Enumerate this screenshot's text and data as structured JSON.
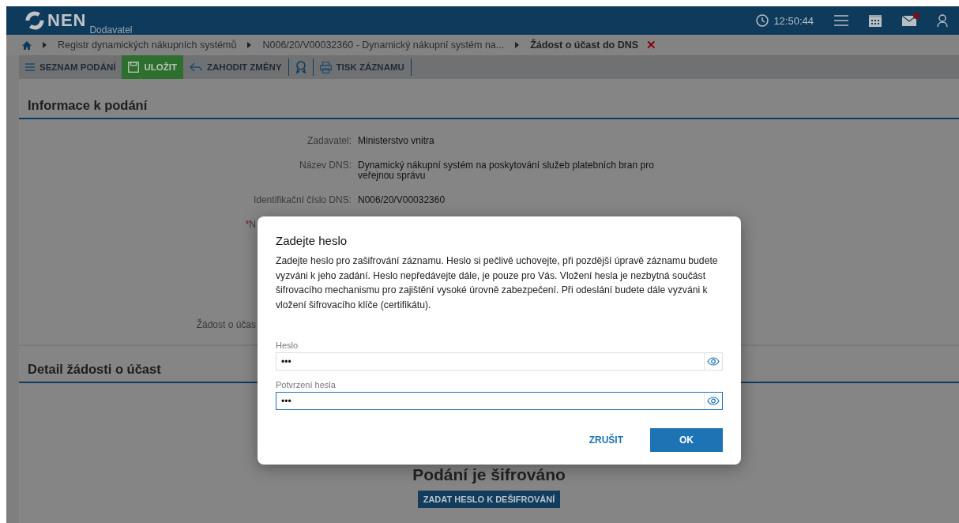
{
  "header": {
    "logo": "NEN",
    "subtitle": "Dodavatel",
    "time": "12:50:44",
    "mail_unread": true
  },
  "breadcrumb": [
    {
      "label": "Registr dynamických nákupních systémů",
      "current": false
    },
    {
      "label": "N006/20/V00032360 - Dynamický nákupní systém na...",
      "current": false
    },
    {
      "label": "Žádost o účast do DNS",
      "current": true,
      "close": "✕"
    }
  ],
  "toolbar": [
    {
      "kind": "list",
      "label": "SEZNAM PODÁNÍ",
      "primary": false
    },
    {
      "kind": "save",
      "label": "ULOŽIT",
      "primary": true
    },
    {
      "kind": "discard",
      "label": "ZAHODIT ZMĚNY",
      "primary": false
    },
    {
      "kind": "award",
      "primary": false
    },
    {
      "kind": "print",
      "label": "TISK ZÁZNAMU",
      "primary": false
    }
  ],
  "info_section": {
    "title": "Informace k podání",
    "fields": [
      {
        "kind": "plain",
        "label": "Zadavatel:",
        "value": "Ministerstvo vnitra"
      },
      {
        "kind": "plain",
        "label": "Název DNS:",
        "value": "Dynamický nákupní systém na poskytování služeb platebních bran pro veřejnou správu"
      },
      {
        "kind": "plain",
        "label": "Identifikační číslo DNS:",
        "value": "N006/20/V00032360"
      },
      {
        "kind": "covered",
        "label": "N",
        "required_mark": "*"
      },
      {
        "kind": "covered",
        "label": "Žádost o účas"
      }
    ]
  },
  "detail_section": {
    "title": "Detail žádosti o účast",
    "message": "Podání je šifrováno",
    "button": "ZADAT HESLO K DEŠIFROVÁNÍ"
  },
  "dialog": {
    "title": "Zadejte heslo",
    "text": "Zadejte heslo pro zašifrování záznamu. Heslo si pečlivě uchovejte, při pozdější úpravě záznamu budete vyzváni k jeho zadání. Heslo nepředávejte dále, je pouze pro Vás. Vložení hesla je nezbytná součást šifrovacího mechanismu pro zajištění vysoké úrovně zabezpečení. Při odeslání budete dále vyzváni k vložení šifrovacího klíče (certifikátu).",
    "fields": [
      {
        "label": "Heslo",
        "value": "•••",
        "focused": false
      },
      {
        "label": "Potvrzení hesla",
        "value": "•••",
        "focused": true
      }
    ],
    "cancel": "ZRUŠIT",
    "ok": "OK"
  }
}
